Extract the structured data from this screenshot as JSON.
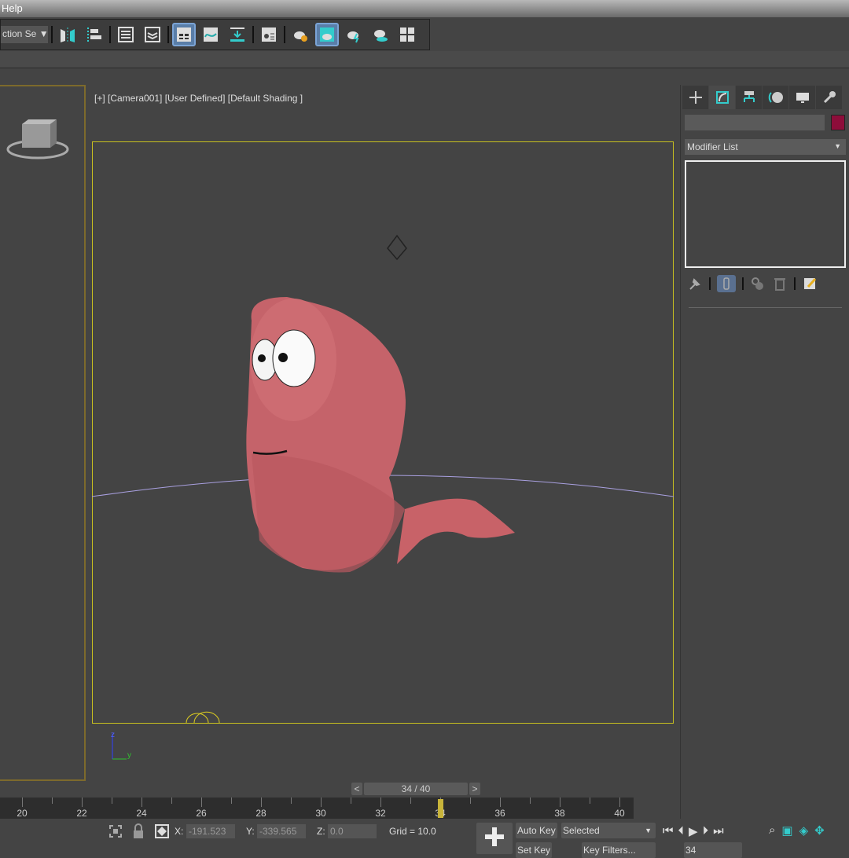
{
  "menubar": {
    "help": "Help"
  },
  "toolbar": {
    "selection_set": "ction Se",
    "selection_set_arrow": "▼"
  },
  "viewport": {
    "label": "[+] [Camera001] [User Defined] [Default Shading ]",
    "axis_z": "z",
    "axis_y": "y"
  },
  "command_panel": {
    "tabs": [
      "create",
      "modify",
      "hierarchy",
      "motion",
      "display",
      "utilities"
    ],
    "modifier_list": "Modifier List",
    "dropdown_arrow": "▼",
    "object_color": "#8d0d3a"
  },
  "time_slider": {
    "prev": "<",
    "value": "34 / 40",
    "next": ">",
    "current_frame": 34,
    "total": 40
  },
  "ruler": {
    "labels": [
      "20",
      "22",
      "24",
      "26",
      "28",
      "30",
      "32",
      "34",
      "36",
      "38",
      "40"
    ]
  },
  "status": {
    "x_label": "X:",
    "x_value": "-191.523",
    "y_label": "Y:",
    "y_value": "-339.565",
    "z_label": "Z:",
    "z_value": "0.0",
    "grid": "Grid = 10.0",
    "auto_key": "Auto Key",
    "selected": "Selected",
    "set_key": "Set Key",
    "key_filters": "Key Filters...",
    "frame": "34"
  }
}
